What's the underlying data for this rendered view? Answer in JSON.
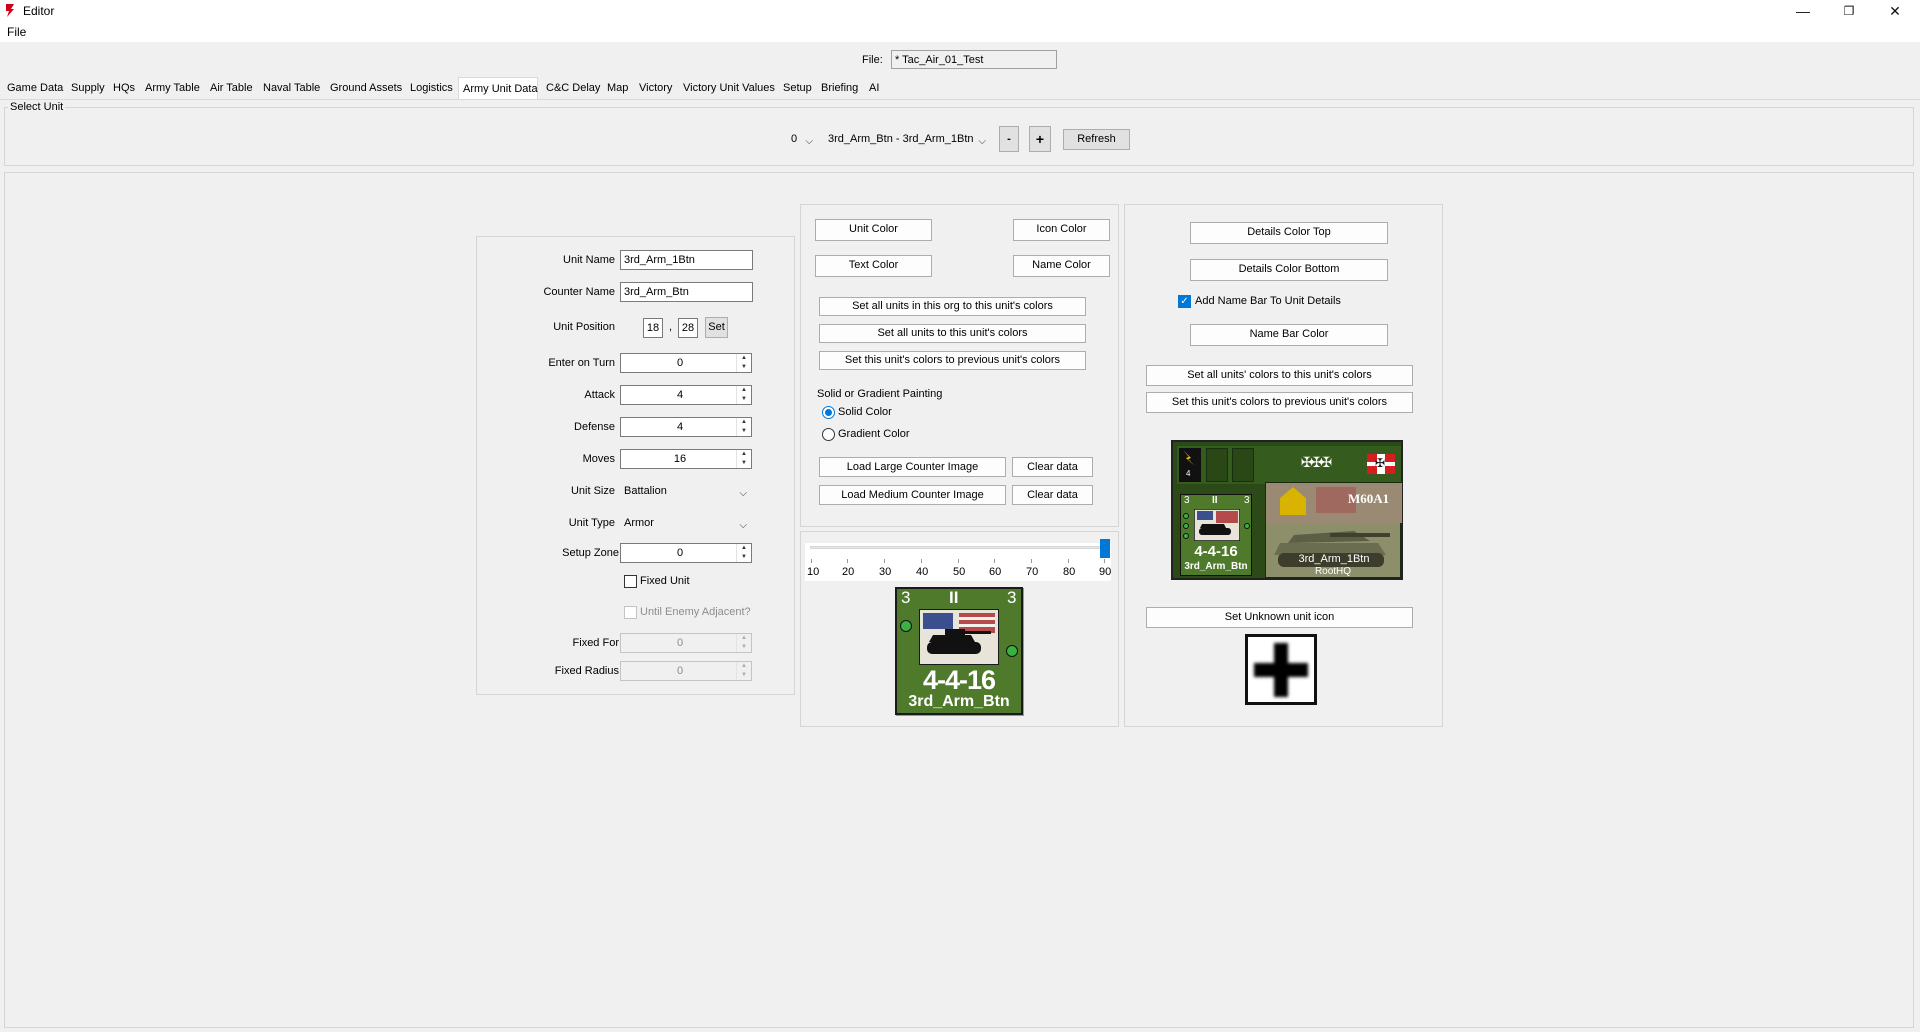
{
  "window": {
    "title": "Editor",
    "minimize_glyph": "—",
    "maximize_glyph": "❐",
    "close_glyph": "✕"
  },
  "menu": {
    "file": "File"
  },
  "file_bar": {
    "label": "File:",
    "value": "* Tac_Air_01_Test"
  },
  "tabs": [
    {
      "label": "Game Data"
    },
    {
      "label": "Supply"
    },
    {
      "label": "HQs"
    },
    {
      "label": "Army Table"
    },
    {
      "label": "Air Table"
    },
    {
      "label": "Naval Table"
    },
    {
      "label": "Ground Assets"
    },
    {
      "label": "Logistics"
    },
    {
      "label": "Army Unit Data"
    },
    {
      "label": "C&C Delay"
    },
    {
      "label": "Map"
    },
    {
      "label": "Victory"
    },
    {
      "label": "Victory Unit Values"
    },
    {
      "label": "Setup"
    },
    {
      "label": "Briefing"
    },
    {
      "label": "AI"
    }
  ],
  "active_tab": "Army Unit Data",
  "select_unit": {
    "group_label": "Select Unit",
    "index_value": "0",
    "unit_value": "3rd_Arm_Btn - 3rd_Arm_1Btn",
    "minus_label": "-",
    "plus_label": "+",
    "refresh_label": "Refresh"
  },
  "unit_form": {
    "unit_name_label": "Unit Name",
    "unit_name": "3rd_Arm_1Btn",
    "counter_name_label": "Counter Name",
    "counter_name": "3rd_Arm_Btn",
    "position_label": "Unit Position",
    "pos_x": "18",
    "pos_sep": ",",
    "pos_y": "28",
    "set_label": "Set",
    "enter_turn_label": "Enter on Turn",
    "enter_turn": "0",
    "attack_label": "Attack",
    "attack": "4",
    "defense_label": "Defense",
    "defense": "4",
    "moves_label": "Moves",
    "moves": "16",
    "size_label": "Unit Size",
    "size": "Battalion",
    "type_label": "Unit Type",
    "type": "Armor",
    "setup_zone_label": "Setup Zone",
    "setup_zone": "0",
    "fixed_unit_label": "Fixed Unit",
    "until_adjacent_label": "Until Enemy Adjacent?",
    "fixed_for_label": "Fixed For",
    "fixed_for": "0",
    "fixed_radius_label": "Fixed Radius",
    "fixed_radius": "0"
  },
  "colors_panel": {
    "unit_color": "Unit Color",
    "icon_color": "Icon Color",
    "text_color": "Text Color",
    "name_color": "Name Color",
    "set_org": "Set all units in this org to this unit's colors",
    "set_all": "Set all units to this unit's colors",
    "set_prev": "Set this unit's colors to previous unit's colors",
    "painting_label": "Solid or Gradient Painting",
    "solid_label": "Solid Color",
    "gradient_label": "Gradient Color",
    "load_large": "Load Large Counter Image",
    "clear_large": "Clear data",
    "load_medium": "Load Medium Counter Image",
    "clear_medium": "Clear data"
  },
  "slider": {
    "value_percent": 100,
    "ticks": [
      "10",
      "20",
      "30",
      "40",
      "50",
      "60",
      "70",
      "80",
      "90"
    ]
  },
  "counter": {
    "corner_left": "3",
    "size_mark": "II",
    "corner_right": "3",
    "stats": "4-4-16",
    "name": "3rd_Arm_Btn"
  },
  "details_panel": {
    "color_top": "Details Color Top",
    "color_bottom": "Details Color Bottom",
    "add_name_bar": "Add Name Bar To Unit Details",
    "name_bar_color": "Name Bar Color",
    "set_all_units": "Set all units' colors to this unit's colors",
    "set_prev": "Set this unit's colors to previous unit's colors",
    "set_unknown": "Set Unknown unit icon"
  },
  "details_card": {
    "level": "4",
    "model": "M60A1",
    "mini_corner_left": "3",
    "mini_size": "II",
    "mini_corner_right": "3",
    "mini_stats": "4-4-16",
    "mini_name": "3rd_Arm_Btn",
    "unit_name": "3rd_Arm_1Btn",
    "hq": "RootHQ"
  },
  "colors": {
    "counter_green": "#4f7a2c",
    "counter_dark": "#2c4a18",
    "accent_blue": "#0078d7",
    "title_red": "#d0021b"
  }
}
